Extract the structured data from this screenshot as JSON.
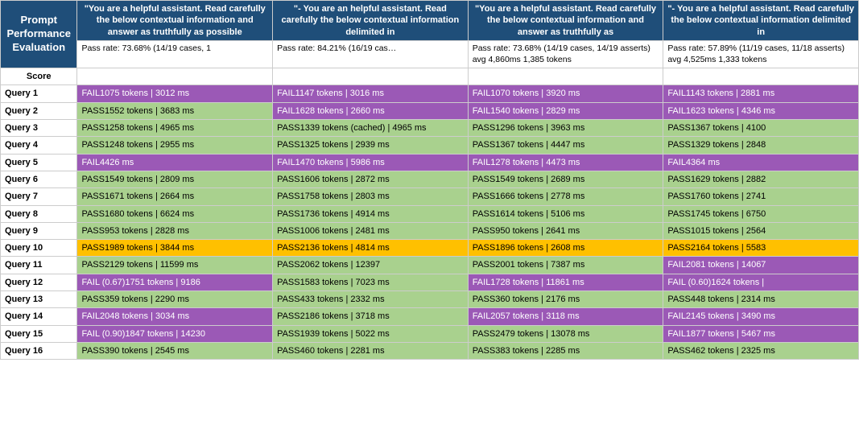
{
  "title": "Prompt Performance Evaluation",
  "prompts": [
    "\"You are a helpful assistant. Read carefully the below contextual information and answer as truthfully as possible",
    "\"- You are an helpful assistant. Read carefully the below contextual information delimited in",
    "\"You are a helpful assistant. Read carefully the below contextual information and answer as truthfully as",
    "\"- You are a helpful assistant. Read carefully the below contextual information delimited in"
  ],
  "passRates": [
    "Pass rate: 73.68% (14/19 cases, 1",
    "Pass rate: 84.21% (16/19 cas…",
    "Pass rate: 73.68% (14/19 cases, 14/19 asserts) avg 4,860ms 1,385 tokens",
    "Pass rate: 57.89% (11/19 cases, 11/18 asserts) avg 4,525ms 1,333 tokens"
  ],
  "scoreLabel": "Score",
  "queries": [
    {
      "label": "Query 1",
      "cells": [
        {
          "text": "FAIL1075 tokens | 3012 ms",
          "style": "bg-purple"
        },
        {
          "text": "FAIL1147 tokens | 3016 ms",
          "style": "bg-purple"
        },
        {
          "text": "FAIL1070 tokens | 3920 ms",
          "style": "bg-purple"
        },
        {
          "text": "FAIL1143 tokens | 2881 ms",
          "style": "bg-purple"
        }
      ]
    },
    {
      "label": "Query 2",
      "cells": [
        {
          "text": "PASS1552 tokens | 3683 ms",
          "style": "bg-green"
        },
        {
          "text": "FAIL1628 tokens | 2660 ms",
          "style": "bg-purple"
        },
        {
          "text": "FAIL1540 tokens | 2829 ms",
          "style": "bg-purple"
        },
        {
          "text": "FAIL1623 tokens | 4346 ms",
          "style": "bg-purple"
        }
      ]
    },
    {
      "label": "Query 3",
      "cells": [
        {
          "text": "PASS1258 tokens | 4965 ms",
          "style": "bg-green"
        },
        {
          "text": "PASS1339 tokens (cached) | 4965 ms",
          "style": "bg-green"
        },
        {
          "text": "PASS1296 tokens | 3963 ms",
          "style": "bg-green"
        },
        {
          "text": "PASS1367 tokens | 4100",
          "style": "bg-green"
        }
      ]
    },
    {
      "label": "Query 4",
      "cells": [
        {
          "text": "PASS1248 tokens | 2955 ms",
          "style": "bg-green"
        },
        {
          "text": "PASS1325 tokens | 2939 ms",
          "style": "bg-green"
        },
        {
          "text": "PASS1367 tokens | 4447 ms",
          "style": "bg-green"
        },
        {
          "text": "PASS1329 tokens | 2848",
          "style": "bg-green"
        }
      ]
    },
    {
      "label": "Query 5",
      "cells": [
        {
          "text": "FAIL4426 ms",
          "style": "bg-purple"
        },
        {
          "text": "FAIL1470 tokens | 5986 ms",
          "style": "bg-purple"
        },
        {
          "text": "FAIL1278 tokens | 4473 ms",
          "style": "bg-purple"
        },
        {
          "text": "FAIL4364 ms",
          "style": "bg-purple"
        }
      ]
    },
    {
      "label": "Query 6",
      "cells": [
        {
          "text": "PASS1549 tokens | 2809 ms",
          "style": "bg-green"
        },
        {
          "text": "PASS1606 tokens | 2872 ms",
          "style": "bg-green"
        },
        {
          "text": "PASS1549 tokens | 2689 ms",
          "style": "bg-green"
        },
        {
          "text": "PASS1629 tokens | 2882",
          "style": "bg-green"
        }
      ]
    },
    {
      "label": "Query 7",
      "cells": [
        {
          "text": "PASS1671 tokens | 2664 ms",
          "style": "bg-green"
        },
        {
          "text": "PASS1758 tokens | 2803 ms",
          "style": "bg-green"
        },
        {
          "text": "PASS1666 tokens | 2778 ms",
          "style": "bg-green"
        },
        {
          "text": "PASS1760 tokens | 2741",
          "style": "bg-green"
        }
      ]
    },
    {
      "label": "Query 8",
      "cells": [
        {
          "text": "PASS1680 tokens | 6624 ms",
          "style": "bg-green"
        },
        {
          "text": "PASS1736 tokens | 4914 ms",
          "style": "bg-green"
        },
        {
          "text": "PASS1614 tokens | 5106 ms",
          "style": "bg-green"
        },
        {
          "text": "PASS1745 tokens | 6750",
          "style": "bg-green"
        }
      ]
    },
    {
      "label": "Query 9",
      "cells": [
        {
          "text": "PASS953 tokens | 2828 ms",
          "style": "bg-green"
        },
        {
          "text": "PASS1006 tokens | 2481 ms",
          "style": "bg-green"
        },
        {
          "text": "PASS950 tokens | 2641 ms",
          "style": "bg-green"
        },
        {
          "text": "PASS1015 tokens | 2564",
          "style": "bg-green"
        }
      ]
    },
    {
      "label": "Query 10",
      "cells": [
        {
          "text": "PASS1989 tokens | 3844 ms",
          "style": "bg-yellow"
        },
        {
          "text": "PASS2136 tokens | 4814 ms",
          "style": "bg-yellow"
        },
        {
          "text": "PASS1896 tokens | 2608 ms",
          "style": "bg-yellow"
        },
        {
          "text": "PASS2164 tokens | 5583",
          "style": "bg-yellow"
        }
      ]
    },
    {
      "label": "Query 11",
      "cells": [
        {
          "text": "PASS2129 tokens | 11599 ms",
          "style": "bg-green"
        },
        {
          "text": "PASS2062 tokens | 12397",
          "style": "bg-green"
        },
        {
          "text": "PASS2001 tokens | 7387 ms",
          "style": "bg-green"
        },
        {
          "text": "FAIL2081 tokens | 14067",
          "style": "bg-purple"
        }
      ]
    },
    {
      "label": "Query 12",
      "cells": [
        {
          "text": "FAIL (0.67)1751 tokens | 9186",
          "style": "bg-purple"
        },
        {
          "text": "PASS1583 tokens | 7023 ms",
          "style": "bg-green"
        },
        {
          "text": "FAIL1728 tokens | 11861 ms",
          "style": "bg-purple"
        },
        {
          "text": "FAIL (0.60)1624 tokens |",
          "style": "bg-purple"
        }
      ]
    },
    {
      "label": "Query 13",
      "cells": [
        {
          "text": "PASS359 tokens | 2290 ms",
          "style": "bg-green"
        },
        {
          "text": "PASS433 tokens | 2332 ms",
          "style": "bg-green"
        },
        {
          "text": "PASS360 tokens | 2176 ms",
          "style": "bg-green"
        },
        {
          "text": "PASS448 tokens | 2314 ms",
          "style": "bg-green"
        }
      ]
    },
    {
      "label": "Query 14",
      "cells": [
        {
          "text": "FAIL2048 tokens | 3034 ms",
          "style": "bg-purple"
        },
        {
          "text": "PASS2186 tokens | 3718 ms",
          "style": "bg-green"
        },
        {
          "text": "FAIL2057 tokens | 3118 ms",
          "style": "bg-purple"
        },
        {
          "text": "FAIL2145 tokens | 3490 ms",
          "style": "bg-purple"
        }
      ]
    },
    {
      "label": "Query 15",
      "cells": [
        {
          "text": "FAIL (0.90)1847 tokens | 14230",
          "style": "bg-purple"
        },
        {
          "text": "PASS1939 tokens | 5022 ms",
          "style": "bg-green"
        },
        {
          "text": "PASS2479 tokens | 13078 ms",
          "style": "bg-green"
        },
        {
          "text": "FAIL1877 tokens | 5467 ms",
          "style": "bg-purple"
        }
      ]
    },
    {
      "label": "Query 16",
      "cells": [
        {
          "text": "PASS390 tokens | 2545 ms",
          "style": "bg-green"
        },
        {
          "text": "PASS460 tokens | 2281 ms",
          "style": "bg-green"
        },
        {
          "text": "PASS383 tokens | 2285 ms",
          "style": "bg-green"
        },
        {
          "text": "PASS462 tokens | 2325 ms",
          "style": "bg-green"
        }
      ]
    }
  ]
}
